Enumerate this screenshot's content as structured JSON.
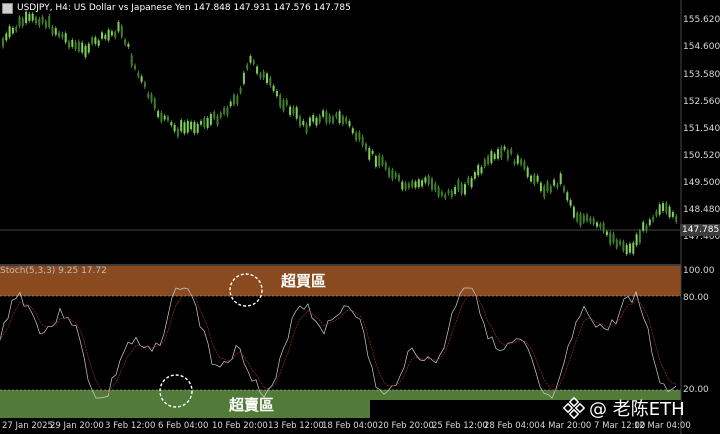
{
  "header": {
    "symbol_line": "USDJPY, H4:  US Dollar vs Japanese Yen  147.848 147.931 147.576 147.785"
  },
  "indicator": {
    "label": "Stoch(5,3,3) 9.25 17.72"
  },
  "price_axis": [
    "155.620",
    "154.600",
    "153.580",
    "152.560",
    "151.540",
    "150.520",
    "149.500",
    "148.480",
    "147.460"
  ],
  "current_price": "147.785",
  "stoch_axis": [
    "100.00",
    "80.00",
    "20.00"
  ],
  "time_axis": [
    "27 Jan 2025",
    "29 Jan 20:00",
    "3 Feb 12:00",
    "6 Feb 04:00",
    "10 Feb 20:00",
    "13 Feb 12:00",
    "18 Feb 04:00",
    "20 Feb 20:00",
    "25 Feb 12:00",
    "28 Feb 04:00",
    "4 Mar 20:00",
    "7 Mar 12:00",
    "12 Mar 04:00"
  ],
  "zones": {
    "overbought": "超買區",
    "oversold": "超賣區"
  },
  "colors": {
    "overbought_band": "#8a4a1f",
    "oversold_band": "#527a38",
    "candle": "#7fd25a"
  },
  "watermark": "@ 老陈ETH"
}
